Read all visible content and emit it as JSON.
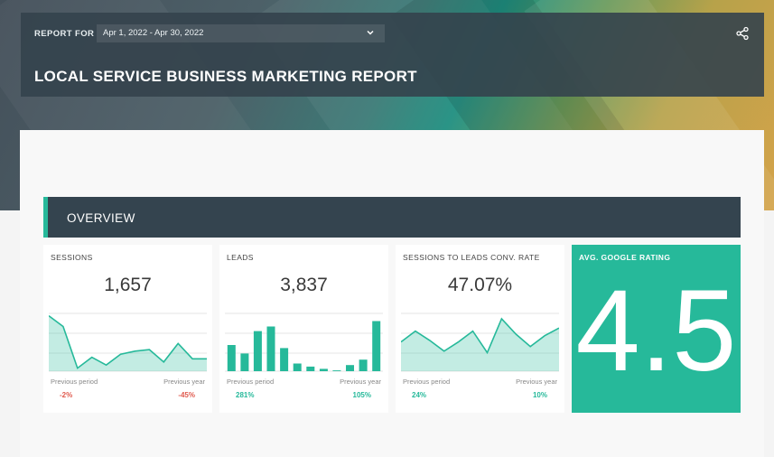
{
  "header": {
    "report_for_label": "REPORT FOR",
    "date_range": "Apr 1, 2022 - Apr 30, 2022",
    "title": "LOCAL SERVICE BUSINESS MARKETING REPORT",
    "share_icon": "share-icon"
  },
  "overview": {
    "section_title": "OVERVIEW",
    "cards": [
      {
        "title": "SESSIONS",
        "value": "1,657",
        "chart_type": "area",
        "trend": [
          72,
          58,
          4,
          18,
          8,
          22,
          26,
          28,
          12,
          36,
          16,
          16
        ],
        "previous_period_label": "Previous period",
        "previous_period_value": "-2%",
        "previous_year_label": "Previous year",
        "previous_year_value": "-45%"
      },
      {
        "title": "LEADS",
        "value": "3,837",
        "chart_type": "bar",
        "trend": [
          34,
          23,
          52,
          58,
          30,
          10,
          6,
          3,
          1,
          8,
          15,
          65
        ],
        "previous_period_label": "Previous period",
        "previous_period_value": "281%",
        "previous_year_label": "Previous year",
        "previous_year_value": "105%"
      },
      {
        "title": "SESSIONS TO LEADS CONV. RATE",
        "value": "47.07%",
        "chart_type": "area",
        "trend": [
          38,
          52,
          40,
          26,
          38,
          52,
          24,
          68,
          48,
          32,
          46,
          56
        ],
        "previous_period_label": "Previous period",
        "previous_period_value": "24%",
        "previous_year_label": "Previous year",
        "previous_year_value": "10%"
      }
    ],
    "rating": {
      "title": "AVG. GOOGLE RATING",
      "value": "4.5"
    }
  },
  "colors": {
    "accent": "#26b99a",
    "header_bg": "#34444f",
    "negative": "#e05a4e",
    "positive": "#26b99a"
  }
}
